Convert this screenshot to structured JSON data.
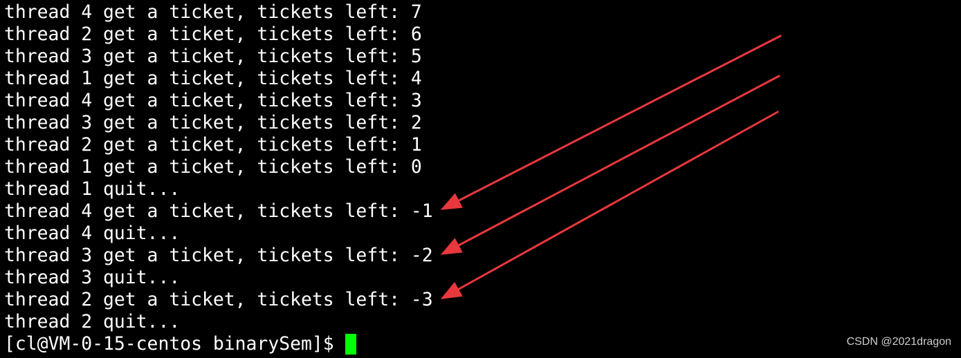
{
  "terminal": {
    "lines": [
      "thread 4 get a ticket, tickets left: 7",
      "thread 2 get a ticket, tickets left: 6",
      "thread 3 get a ticket, tickets left: 5",
      "thread 1 get a ticket, tickets left: 4",
      "thread 4 get a ticket, tickets left: 3",
      "thread 3 get a ticket, tickets left: 2",
      "thread 2 get a ticket, tickets left: 1",
      "thread 1 get a ticket, tickets left: 0",
      "thread 1 quit...",
      "thread 4 get a ticket, tickets left: -1",
      "thread 4 quit...",
      "thread 3 get a ticket, tickets left: -2",
      "thread 3 quit...",
      "thread 2 get a ticket, tickets left: -3",
      "thread 2 quit..."
    ],
    "prompt": "[cl@VM-0-15-centos binarySem]$",
    "cursor_color": "#00ff00"
  },
  "annotations": {
    "arrow_color": "#e8383d",
    "arrow_targets": [
      "-1",
      "-2",
      "-3"
    ]
  },
  "watermark": "CSDN @2021dragon"
}
